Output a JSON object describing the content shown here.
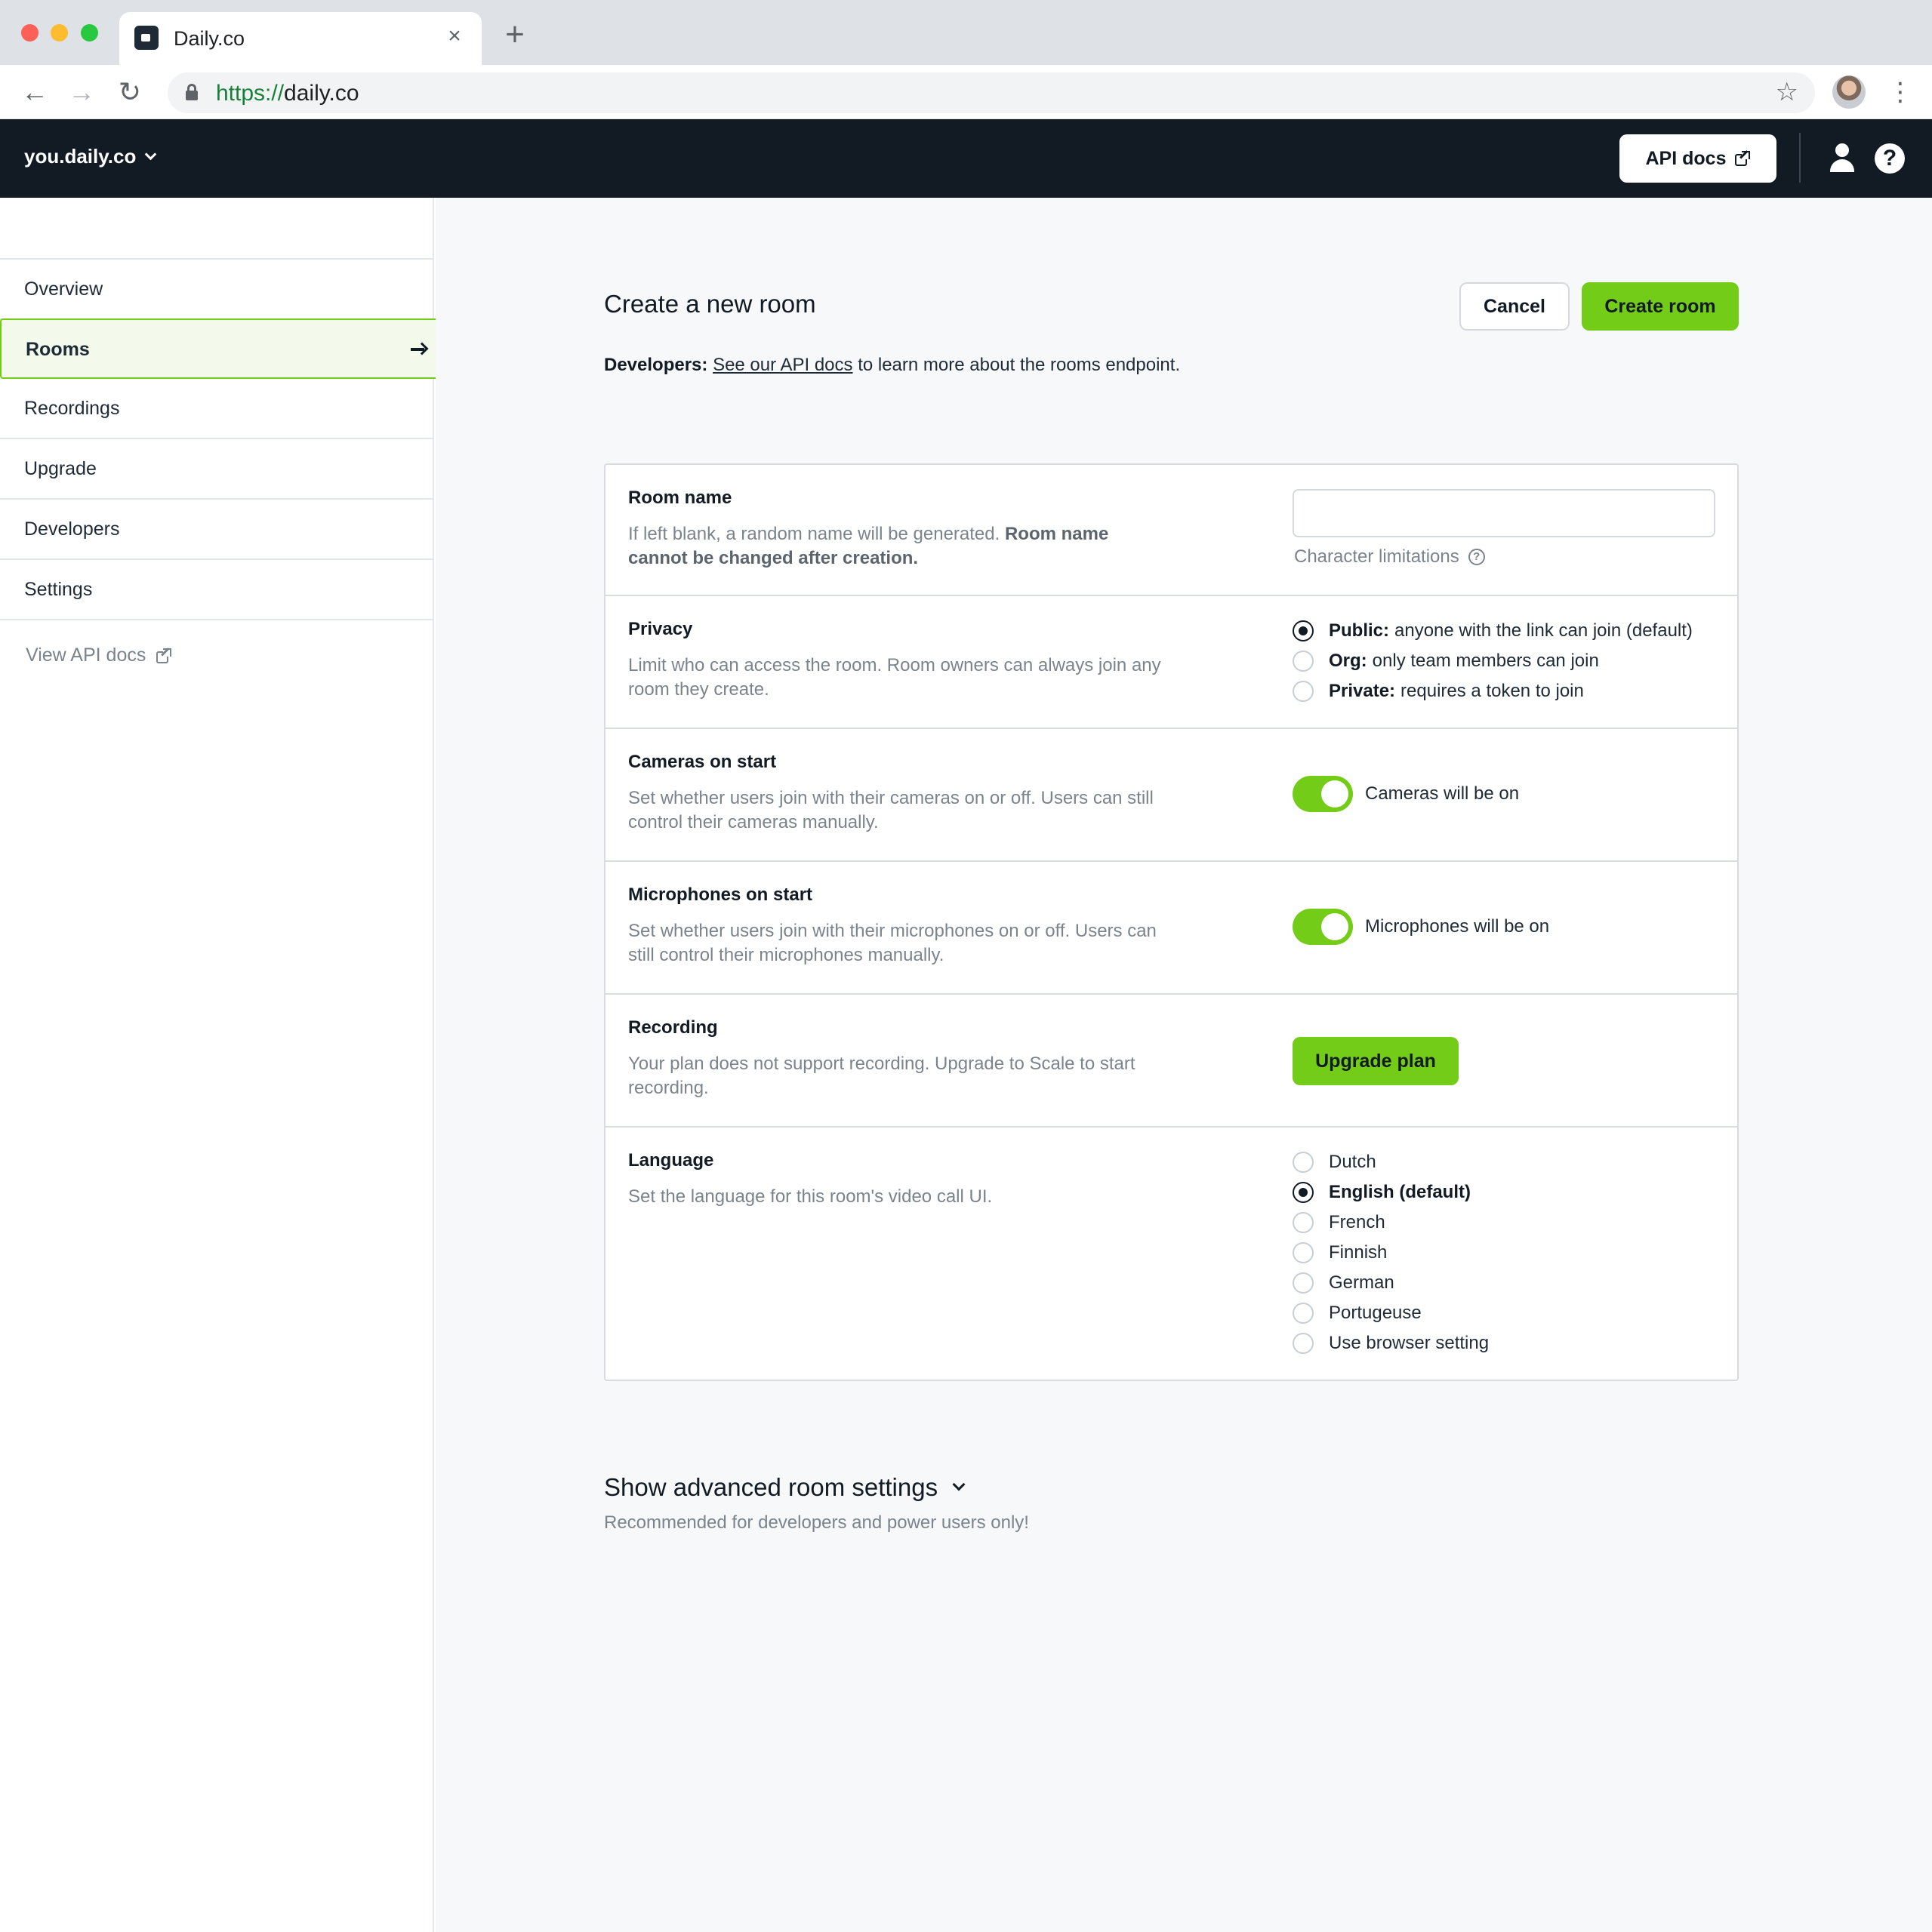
{
  "browser": {
    "tab_title": "Daily.co",
    "tab_close": "×",
    "new_tab": "+",
    "url_scheme": "https://",
    "url_host": "daily.co"
  },
  "header": {
    "domain": "you.daily.co",
    "api_docs_label": "API docs",
    "help_glyph": "?"
  },
  "sidebar": {
    "items": [
      {
        "label": "Overview"
      },
      {
        "label": "Rooms",
        "active": true
      },
      {
        "label": "Recordings"
      },
      {
        "label": "Upgrade"
      },
      {
        "label": "Developers"
      },
      {
        "label": "Settings"
      }
    ],
    "view_api_docs": "View API docs"
  },
  "main": {
    "title": "Create a new room",
    "cancel_label": "Cancel",
    "create_label": "Create room",
    "dev_note_prefix": "Developers:",
    "dev_note_link": "See our API docs",
    "dev_note_suffix": "to learn more about the rooms endpoint.",
    "room_name": {
      "title": "Room name",
      "desc_plain": "If left blank, a random name will be generated.",
      "desc_bold": "Room name cannot be changed after creation.",
      "input_value": "",
      "char_limits": "Character limitations"
    },
    "privacy": {
      "title": "Privacy",
      "desc": "Limit who can access the room. Room owners can always join any room they create.",
      "options": [
        {
          "bold": "Public:",
          "text": "anyone with the link can join (default)",
          "checked": true
        },
        {
          "bold": "Org:",
          "text": "only team members can join",
          "checked": false
        },
        {
          "bold": "Private:",
          "text": "requires a token to join",
          "checked": false
        }
      ]
    },
    "cameras": {
      "title": "Cameras on start",
      "desc": "Set whether users join with their cameras on or off. Users can still control their cameras manually.",
      "toggle_label": "Cameras will be on",
      "on": true
    },
    "microphones": {
      "title": "Microphones on start",
      "desc": "Set whether users join with their microphones on or off. Users can still control their microphones manually.",
      "toggle_label": "Microphones will be on",
      "on": true
    },
    "recording": {
      "title": "Recording",
      "desc": "Your plan does not support recording. Upgrade to Scale to start recording.",
      "upgrade_label": "Upgrade plan"
    },
    "language": {
      "title": "Language",
      "desc": "Set the language for this room's video call UI.",
      "options": [
        {
          "label": "Dutch",
          "checked": false
        },
        {
          "label": "English (default)",
          "checked": true
        },
        {
          "label": "French",
          "checked": false
        },
        {
          "label": "Finnish",
          "checked": false
        },
        {
          "label": "German",
          "checked": false
        },
        {
          "label": "Portugeuse",
          "checked": false
        },
        {
          "label": "Use browser setting",
          "checked": false
        }
      ]
    },
    "advanced": {
      "title": "Show advanced room settings",
      "subtitle": "Recommended for developers and power users only!"
    }
  },
  "colors": {
    "accent": "#72cc18",
    "header_bg": "#121a24",
    "main_bg": "#f7f8f9"
  }
}
